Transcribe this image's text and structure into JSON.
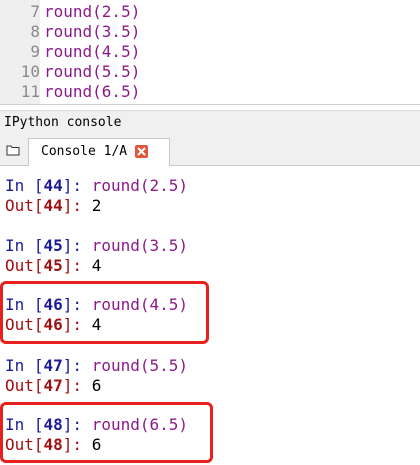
{
  "editor": {
    "lines": [
      {
        "number": "7",
        "code": "round(2.5)"
      },
      {
        "number": "8",
        "code": "round(3.5)"
      },
      {
        "number": "9",
        "code": "round(4.5)"
      },
      {
        "number": "10",
        "code": "round(5.5)"
      },
      {
        "number": "11",
        "code": "round(6.5)"
      }
    ]
  },
  "console_pane": {
    "title": "IPython console",
    "tab_label": "Console 1/A"
  },
  "console": {
    "entries": [
      {
        "in_prefix": "In [",
        "in_num": "44",
        "in_suffix": "]: ",
        "call": "round(2.5)",
        "out_prefix": "Out[",
        "out_num": "44",
        "out_suffix": "]: ",
        "result": "2"
      },
      {
        "in_prefix": "In [",
        "in_num": "45",
        "in_suffix": "]: ",
        "call": "round(3.5)",
        "out_prefix": "Out[",
        "out_num": "45",
        "out_suffix": "]: ",
        "result": "4"
      },
      {
        "in_prefix": "In [",
        "in_num": "46",
        "in_suffix": "]: ",
        "call": "round(4.5)",
        "out_prefix": "Out[",
        "out_num": "46",
        "out_suffix": "]: ",
        "result": "4"
      },
      {
        "in_prefix": "In [",
        "in_num": "47",
        "in_suffix": "]: ",
        "call": "round(5.5)",
        "out_prefix": "Out[",
        "out_num": "47",
        "out_suffix": "]: ",
        "result": "6"
      },
      {
        "in_prefix": "In [",
        "in_num": "48",
        "in_suffix": "]: ",
        "call": "round(6.5)",
        "out_prefix": "Out[",
        "out_num": "48",
        "out_suffix": "]: ",
        "result": "6"
      }
    ]
  },
  "colors": {
    "highlight": "#e8201e",
    "in_prompt": "#1a1a9a",
    "out_prompt": "#a01010",
    "call": "#8b1a8b"
  }
}
